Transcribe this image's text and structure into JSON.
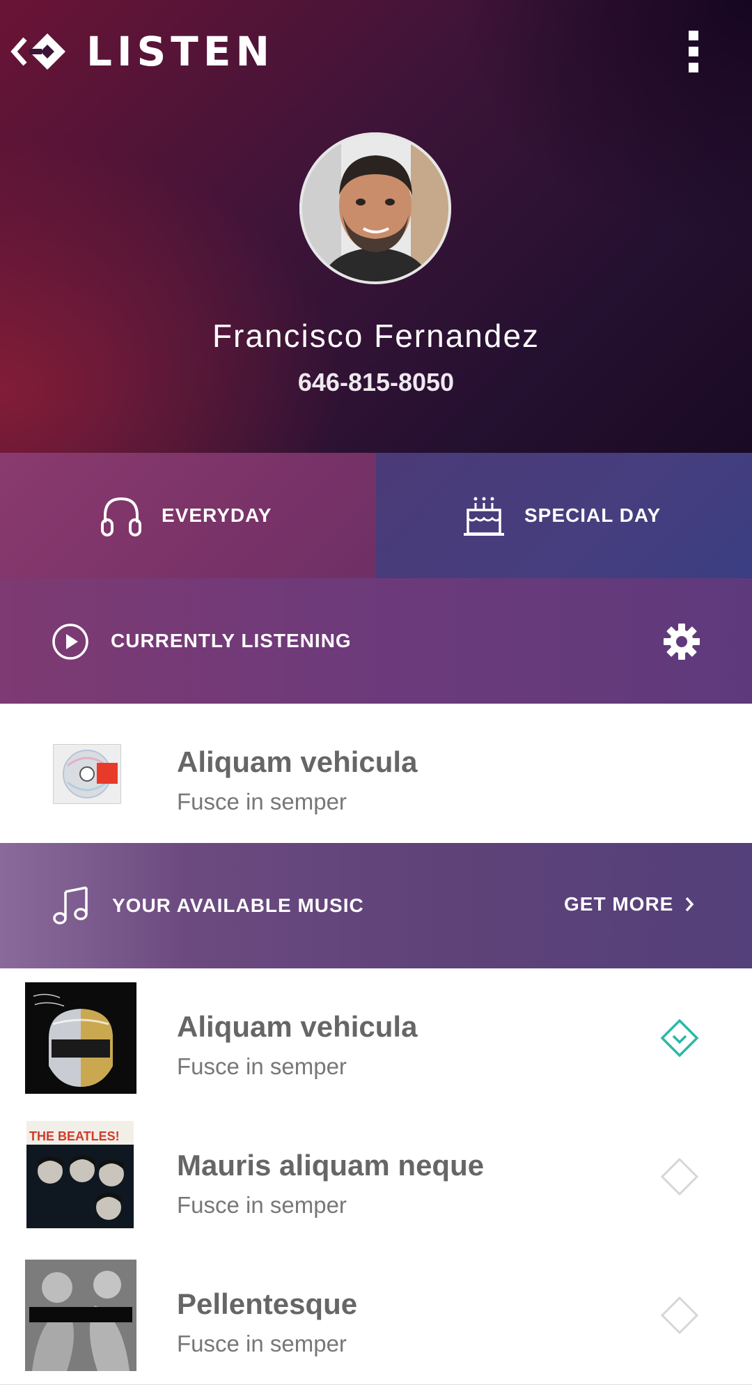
{
  "app": {
    "logo_text": "LISTEN"
  },
  "profile": {
    "name": "Francisco Fernandez",
    "phone": "646-815-8050"
  },
  "tabs": [
    {
      "label": "EVERYDAY",
      "icon": "headphones-icon"
    },
    {
      "label": "SPECIAL DAY",
      "icon": "birthday-cake-icon"
    }
  ],
  "current": {
    "header": "CURRENTLY LISTENING",
    "track": {
      "title": "Aliquam vehicula",
      "subtitle": "Fusce in semper"
    }
  },
  "available": {
    "header": "YOUR AVAILABLE MUSIC",
    "get_more": "GET MORE",
    "tracks": [
      {
        "title": "Aliquam vehicula",
        "subtitle": "Fusce in semper",
        "selected": true
      },
      {
        "title": "Mauris aliquam neque",
        "subtitle": "Fusce in semper",
        "selected": false
      },
      {
        "title": "Pellentesque",
        "subtitle": "Fusce in semper",
        "selected": false
      }
    ]
  },
  "colors": {
    "accent": "#2bb8a6",
    "text_primary": "#666666",
    "text_secondary": "#777777"
  }
}
